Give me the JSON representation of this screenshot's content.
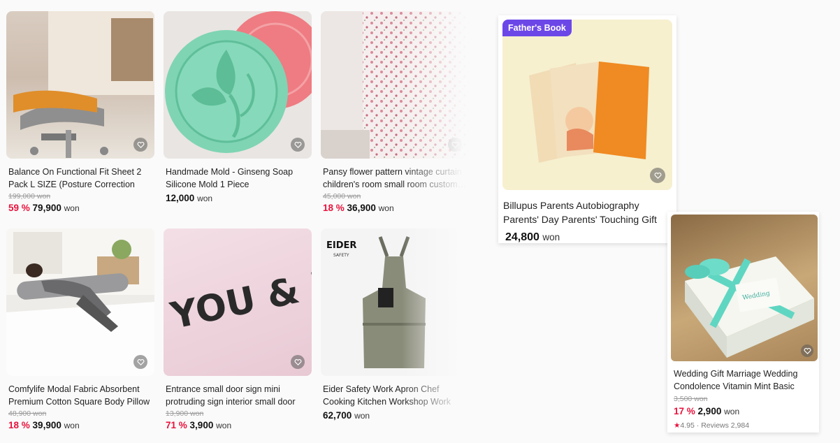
{
  "products": [
    {
      "title": "Balance On Functional Fit Sheet 2 Pack L SIZE (Posture Correction Examin…",
      "original_price": "199,000 won",
      "discount": "59 %",
      "price": "79,900",
      "currency": "won"
    },
    {
      "title": "Handmade Mold - Ginseng Soap Silicone Mold 1 Piece",
      "original_price": "",
      "discount": "",
      "price": "12,000",
      "currency": "won"
    },
    {
      "title": "Pansy flower pattern vintage curtain children's room small room custom…",
      "original_price": "45,000 won",
      "discount": "18 %",
      "price": "36,900",
      "currency": "won"
    },
    {
      "title": "Comfylife Modal Fabric Absorbent Premium Cotton Square Body Pillow C…",
      "original_price": "48,900 won",
      "discount": "18 %",
      "price": "39,900",
      "currency": "won"
    },
    {
      "title": "Entrance small door sign mini protruding sign interior small door name tag",
      "original_price": "13,900 won",
      "discount": "71 %",
      "price": "3,900",
      "currency": "won"
    },
    {
      "title": "Eider Safety Work Apron Chef Cooking Kitchen Workshop Work Multipurp…",
      "original_price": "",
      "discount": "",
      "price": "62,700",
      "currency": "won"
    }
  ],
  "featured": {
    "badge": "Father's Book",
    "title": "Billupus Parents Autobiography Parents' Day Parents' Touching Gift Event",
    "price": "24,800",
    "currency": "won"
  },
  "gift": {
    "title": "Wedding Gift Marriage Wedding Condolence Vitamin Mint Basic Premium …",
    "original_price": "3,500 won",
    "discount": "17 %",
    "price": "2,900",
    "currency": "won",
    "rating": "4.95",
    "reviews": "Reviews 2,984"
  },
  "image_text": {
    "you_and_i": "YOU & I",
    "eider_brand": "EIDER",
    "eider_sub": "SAFETY",
    "gift_card_word": "Wedding"
  },
  "colors": {
    "discount": "#e8123c",
    "badge": "#6c47e8"
  }
}
